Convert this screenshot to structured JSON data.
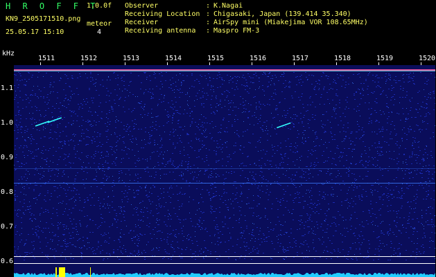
{
  "header": {
    "title": "H R O F F T",
    "version": "1.0.0f",
    "filename": "KN9_2505171510.png",
    "timestamp": "25.05.17 15:10",
    "meteor_label": "meteor",
    "meteor_count": "4"
  },
  "info": [
    {
      "label": "Observer",
      "value": "K.Nagai"
    },
    {
      "label": "Receiving Location",
      "value": "Chigasaki, Japan (139.414 35.340)"
    },
    {
      "label": "Receiver",
      "value": "AirSpy mini (Miakejima VOR 108.65MHz)"
    },
    {
      "label": "Receiving antenna",
      "value": "Maspro FM-3"
    }
  ],
  "axis": {
    "y_unit": "kHz",
    "y_ticks": [
      "1.1",
      "1.0",
      "0.9",
      "0.8",
      "0.7",
      "0.6"
    ],
    "x_ticks": [
      "1511",
      "1512",
      "1513",
      "1514",
      "1515",
      "1516",
      "1517",
      "1518",
      "1519",
      "1520"
    ]
  },
  "colors": {
    "background": "#0a0d5a",
    "noise_dim": "#1a2ab0",
    "noise_bright": "#3a7cff",
    "carrier_pink": "#ff66aa",
    "carrier_cyan": "#33ffff",
    "signal_level": "#22ccff",
    "meteor_marker": "#ffff00",
    "ref_line": "#ffffff"
  },
  "meteors": [
    {
      "minute": 1511.05,
      "freq_khz": 1.0
    },
    {
      "minute": 1511.34,
      "freq_khz": 1.01
    },
    {
      "minute": 1516.76,
      "freq_khz": 0.995
    }
  ]
}
